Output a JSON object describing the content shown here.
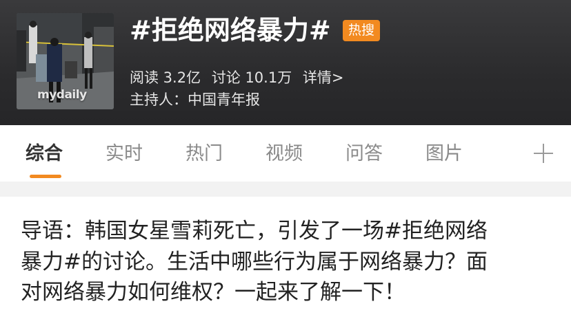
{
  "header": {
    "title": "#拒绝网络暴力#",
    "hot_badge": "热搜",
    "reads": "阅读 3.2亿",
    "discussions": "讨论 10.1万",
    "details_link": "详情>",
    "host": "主持人：中国青年报",
    "thumbnail_watermark": "mydaily"
  },
  "tabs": [
    {
      "label": "综合",
      "active": true
    },
    {
      "label": "实时",
      "active": false
    },
    {
      "label": "热门",
      "active": false
    },
    {
      "label": "视频",
      "active": false
    },
    {
      "label": "问答",
      "active": false
    },
    {
      "label": "图片",
      "active": false
    }
  ],
  "add_tab_icon": "plus-icon",
  "article": {
    "lead_lines": [
      "导语：韩国女星雪莉死亡，引发了一场#拒绝网络",
      "暴力#的讨论。生活中哪些行为属于网络暴力？面",
      "对网络暴力如何维权？一起来了解一下！"
    ]
  },
  "colors": {
    "header_bg": "#2b2b2d",
    "accent": "#f28a20",
    "page_bg": "#f2f2f2",
    "active_tab_text": "#333333",
    "inactive_tab_text": "#8a8a8a"
  }
}
